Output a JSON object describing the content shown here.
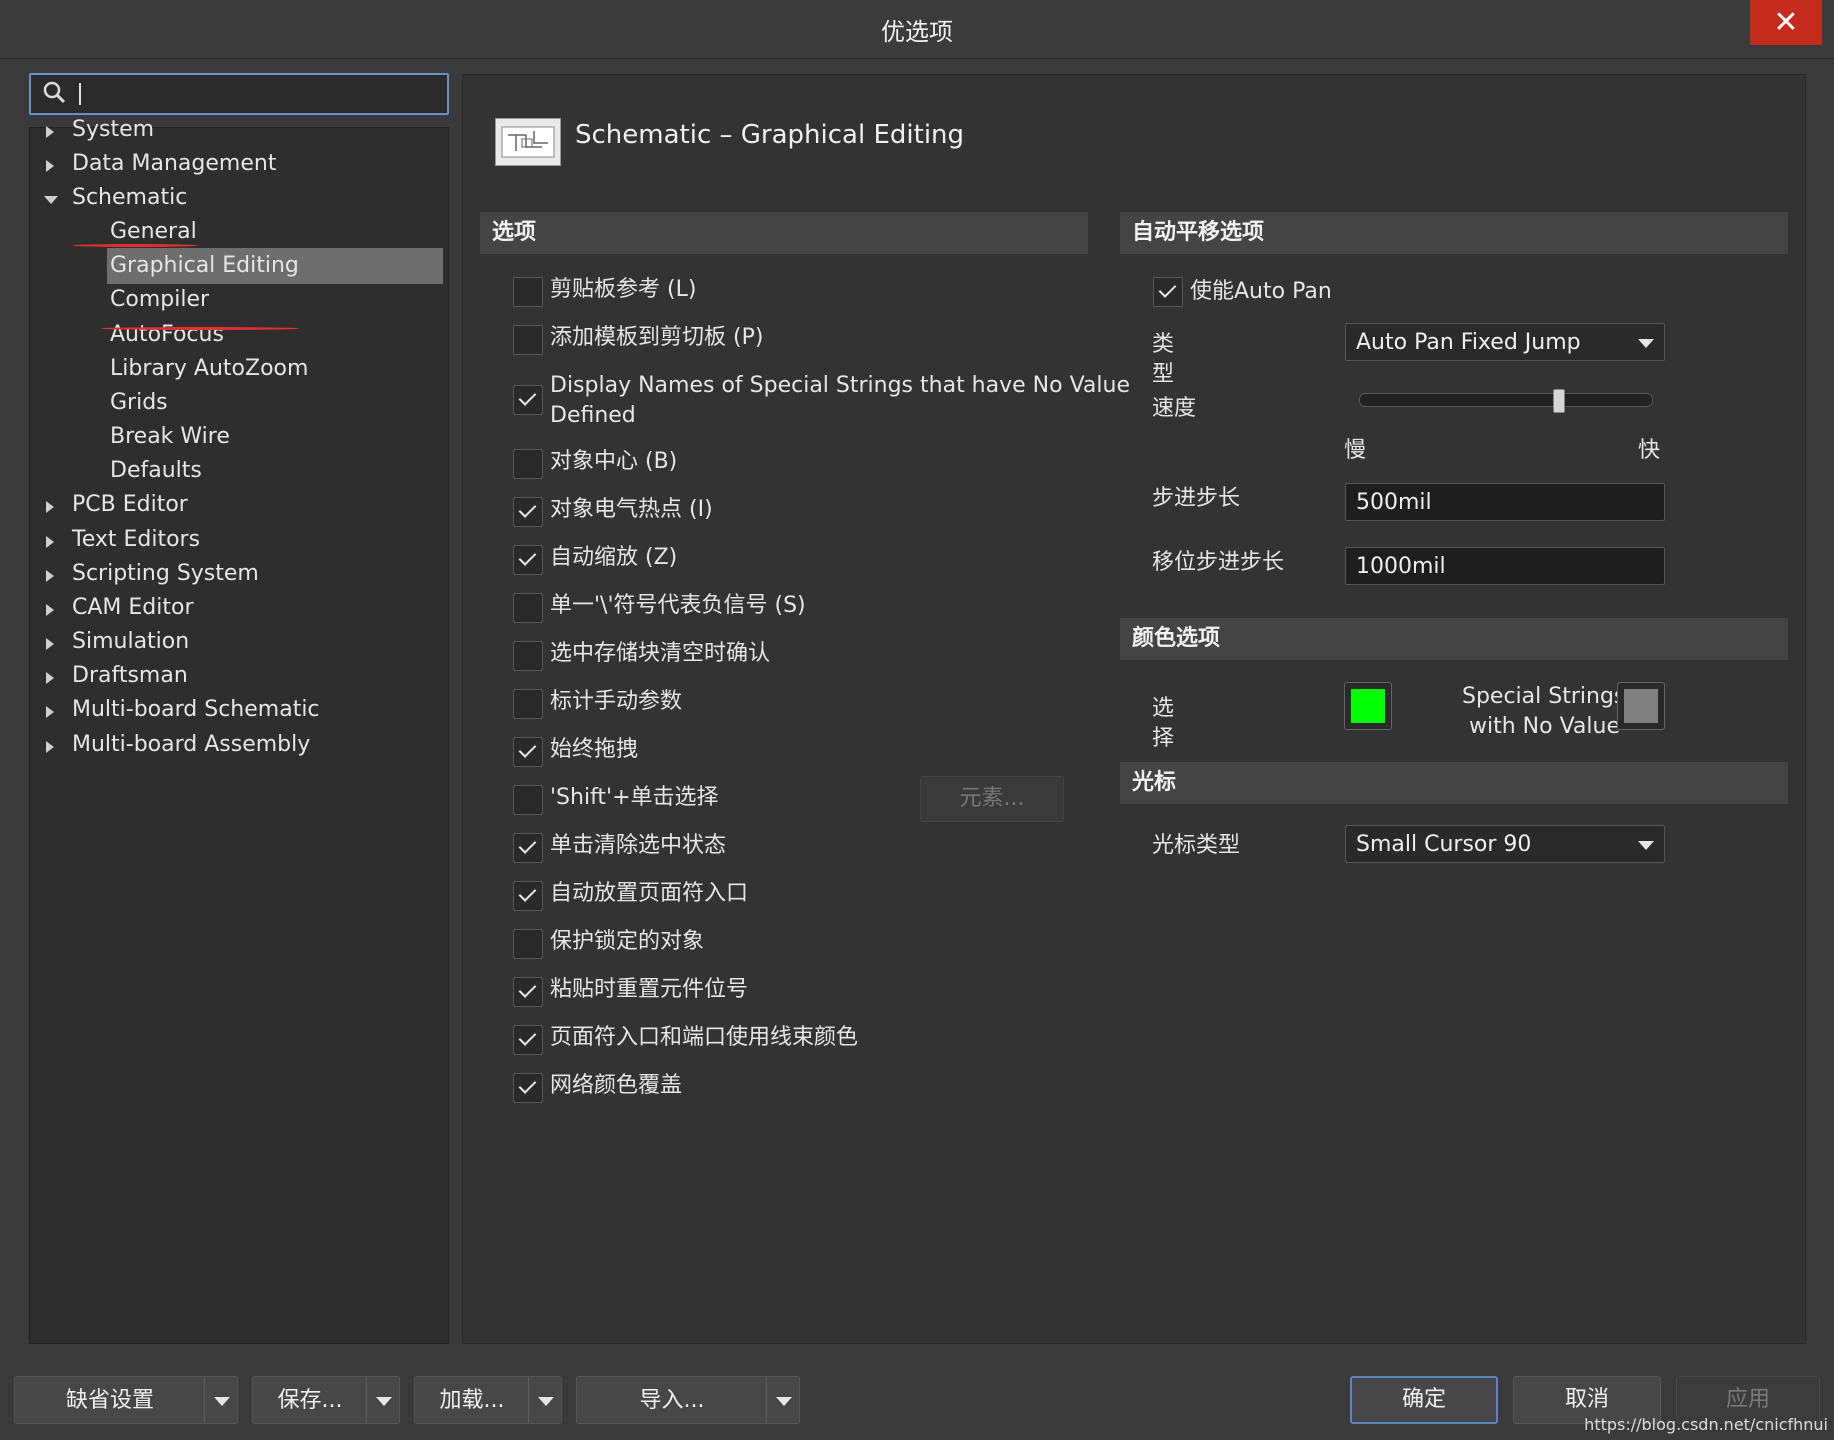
{
  "window": {
    "title": "优选项"
  },
  "search": {
    "placeholder": ""
  },
  "tree": [
    {
      "label": "System",
      "expanded": false
    },
    {
      "label": "Data Management",
      "expanded": false
    },
    {
      "label": "Schematic",
      "expanded": true
    },
    {
      "label": "General"
    },
    {
      "label": "Graphical Editing",
      "selected": true
    },
    {
      "label": "Compiler"
    },
    {
      "label": "AutoFocus"
    },
    {
      "label": "Library AutoZoom"
    },
    {
      "label": "Grids"
    },
    {
      "label": "Break Wire"
    },
    {
      "label": "Defaults"
    },
    {
      "label": "PCB Editor",
      "expanded": false
    },
    {
      "label": "Text Editors",
      "expanded": false
    },
    {
      "label": "Scripting System",
      "expanded": false
    },
    {
      "label": "CAM Editor",
      "expanded": false
    },
    {
      "label": "Simulation",
      "expanded": false
    },
    {
      "label": "Draftsman",
      "expanded": false
    },
    {
      "label": "Multi-board Schematic",
      "expanded": false
    },
    {
      "label": "Multi-board Assembly",
      "expanded": false
    }
  ],
  "page": {
    "title": "Schematic – Graphical Editing"
  },
  "options": {
    "header": "选项",
    "items": [
      {
        "label": "剪贴板参考 (L)",
        "checked": false
      },
      {
        "label": "添加模板到剪切板 (P)",
        "checked": false
      },
      {
        "label": "Display Names of Special Strings that have No Value",
        "label2": "Defined",
        "checked": true
      },
      {
        "label": "对象中心 (B)",
        "checked": false
      },
      {
        "label": "对象电气热点 (I)",
        "checked": true
      },
      {
        "label": "自动缩放 (Z)",
        "checked": true
      },
      {
        "label": "单一'\\'符号代表负信号 (S)",
        "checked": false
      },
      {
        "label": "选中存储块清空时确认",
        "checked": false
      },
      {
        "label": "标计手动参数",
        "checked": false
      },
      {
        "label": "始终拖拽",
        "checked": true
      },
      {
        "label": "'Shift'+单击选择",
        "checked": false
      },
      {
        "label": "单击清除选中状态",
        "checked": true
      },
      {
        "label": "自动放置页面符入口",
        "checked": true
      },
      {
        "label": "保护锁定的对象",
        "checked": false
      },
      {
        "label": "粘贴时重置元件位号",
        "checked": true
      },
      {
        "label": "页面符入口和端口使用线束颜色",
        "checked": true
      },
      {
        "label": "网络颜色覆盖",
        "checked": true
      }
    ],
    "elements_button": "元素..."
  },
  "autopan": {
    "header": "自动平移选项",
    "enable_label": "使能Auto Pan",
    "enable_checked": true,
    "type_label_1": "类",
    "type_label_2": "型",
    "type_value": "Auto Pan Fixed Jump",
    "speed_label": "速度",
    "speed_value": 0.68,
    "slow_label": "慢",
    "fast_label": "快",
    "step_label": "步进步长",
    "step_value": "500mil",
    "shift_step_label": "移位步进步长",
    "shift_step_value": "1000mil"
  },
  "colors": {
    "header": "颜色选项",
    "select_label_1": "选",
    "select_label_2": "择",
    "select_color": "#00ff00",
    "special_label_1": "Special Strings",
    "special_label_2": "with No Value",
    "special_color": "#808080"
  },
  "cursor": {
    "header": "光标",
    "type_label": "光标类型",
    "type_value": "Small Cursor 90"
  },
  "footer": {
    "defaults": "缺省设置",
    "save": "保存...",
    "load": "加载...",
    "import": "导入...",
    "ok": "确定",
    "cancel": "取消",
    "apply": "应用"
  },
  "watermark": "https://blog.csdn.net/cnicfhnui"
}
